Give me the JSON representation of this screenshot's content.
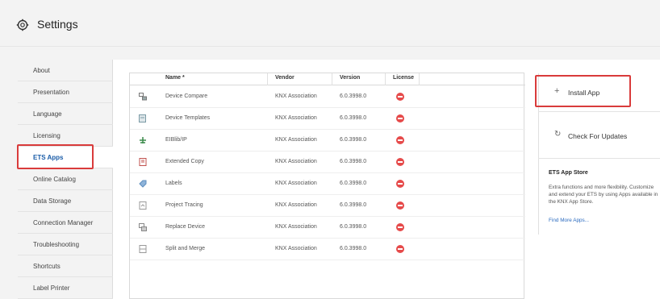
{
  "header": {
    "title": "Settings",
    "icon": "gear-icon"
  },
  "sidebar": {
    "items": [
      {
        "label": "About"
      },
      {
        "label": "Presentation"
      },
      {
        "label": "Language"
      },
      {
        "label": "Licensing"
      },
      {
        "label": "ETS Apps",
        "active": true
      },
      {
        "label": "Online Catalog"
      },
      {
        "label": "Data Storage"
      },
      {
        "label": "Connection Manager"
      },
      {
        "label": "Troubleshooting"
      },
      {
        "label": "Shortcuts"
      },
      {
        "label": "Label Printer"
      }
    ]
  },
  "table": {
    "columns": {
      "name": "Name *",
      "vendor": "Vendor",
      "version": "Version",
      "license": "License"
    },
    "rows": [
      {
        "icon": "device-compare-icon",
        "name": "Device Compare",
        "vendor": "KNX Association",
        "version": "6.0.3998.0",
        "license_icon": "minus-circle-icon"
      },
      {
        "icon": "device-templates-icon",
        "name": "Device Templates",
        "vendor": "KNX Association",
        "version": "6.0.3998.0",
        "license_icon": "minus-circle-icon"
      },
      {
        "icon": "eiblib-icon",
        "name": "EIBlib/IP",
        "vendor": "KNX Association",
        "version": "6.0.3998.0",
        "license_icon": "minus-circle-icon"
      },
      {
        "icon": "extended-copy-icon",
        "name": "Extended Copy",
        "vendor": "KNX Association",
        "version": "6.0.3998.0",
        "license_icon": "minus-circle-icon"
      },
      {
        "icon": "labels-icon",
        "name": "Labels",
        "vendor": "KNX Association",
        "version": "6.0.3998.0",
        "license_icon": "minus-circle-icon"
      },
      {
        "icon": "project-tracing-icon",
        "name": "Project Tracing",
        "vendor": "KNX Association",
        "version": "6.0.3998.0",
        "license_icon": "minus-circle-icon"
      },
      {
        "icon": "replace-device-icon",
        "name": "Replace Device",
        "vendor": "KNX Association",
        "version": "6.0.3998.0",
        "license_icon": "minus-circle-icon"
      },
      {
        "icon": "split-merge-icon",
        "name": "Split and Merge",
        "vendor": "KNX Association",
        "version": "6.0.3998.0",
        "license_icon": "minus-circle-icon"
      }
    ]
  },
  "actions": {
    "install_glyph": "+",
    "install_label": "Install App",
    "update_glyph": "↻",
    "update_label": "Check For Updates"
  },
  "store": {
    "title": "ETS App Store",
    "description": "Extra functions and more flexibility. Customize and extend your ETS by using Apps available in the KNX App Store.",
    "link": "Find More Apps..."
  },
  "colors": {
    "highlight": "#d93b3b",
    "accent": "#1a5ca8",
    "license_red": "#e64a4a"
  }
}
